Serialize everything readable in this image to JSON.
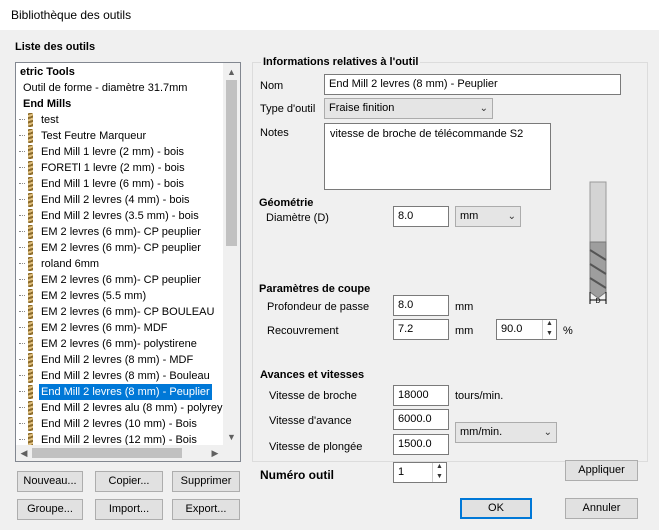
{
  "window": {
    "title": "Bibliothèque des outils"
  },
  "tools_list": {
    "heading": "Liste des outils",
    "rows": [
      {
        "label": "etric Tools",
        "kind": "root"
      },
      {
        "label": "Outil de forme - diamètre 31.7mm",
        "kind": "plain"
      },
      {
        "label": "End Mills",
        "kind": "group"
      },
      {
        "label": "test",
        "kind": "item"
      },
      {
        "label": "Test Feutre Marqueur",
        "kind": "item"
      },
      {
        "label": "End Mill 1 levre (2 mm) - bois",
        "kind": "item"
      },
      {
        "label": "FORETl 1 levre (2 mm) - bois",
        "kind": "item"
      },
      {
        "label": "End Mill 1 levre (6 mm) - bois",
        "kind": "item"
      },
      {
        "label": "End Mill 2 levres (4 mm) - bois",
        "kind": "item"
      },
      {
        "label": "End Mill 2 levres (3.5 mm) - bois",
        "kind": "item"
      },
      {
        "label": "EM 2 levres (6 mm)- CP peuplier",
        "kind": "item"
      },
      {
        "label": "EM 2 levres (6 mm)- CP peuplier",
        "kind": "item"
      },
      {
        "label": "roland 6mm",
        "kind": "item"
      },
      {
        "label": "EM 2 levres (6 mm)- CP peuplier",
        "kind": "item"
      },
      {
        "label": "EM 2 levres (5.5 mm)",
        "kind": "item"
      },
      {
        "label": "EM 2 levres (6 mm)- CP BOULEAU",
        "kind": "item"
      },
      {
        "label": "EM 2 levres (6 mm)- MDF",
        "kind": "item"
      },
      {
        "label": "EM 2 levres (6 mm)- polystirene",
        "kind": "item"
      },
      {
        "label": "End Mill 2 levres (8 mm) - MDF",
        "kind": "item"
      },
      {
        "label": "End Mill 2 levres (8 mm) - Bouleau",
        "kind": "item"
      },
      {
        "label": "End Mill 2 levres (8 mm) - Peuplier",
        "kind": "item",
        "selected": true
      },
      {
        "label": "End Mill 2 levres alu (8 mm) - polyrey",
        "kind": "item"
      },
      {
        "label": "End Mill 2 levres (10 mm) - Bois",
        "kind": "item"
      },
      {
        "label": "End Mill 2 levres (12 mm) - Bois",
        "kind": "item"
      }
    ]
  },
  "buttons": {
    "new": "Nouveau...",
    "copy": "Copier...",
    "delete": "Supprimer",
    "group": "Groupe...",
    "import": "Import...",
    "export": "Export...",
    "apply": "Appliquer",
    "ok": "OK",
    "cancel": "Annuler"
  },
  "info": {
    "heading": "Informations relatives à l'outil",
    "name_label": "Nom",
    "name_value": "End Mill 2 levres (8 mm) - Peuplier",
    "type_label": "Type d'outil",
    "type_value": "Fraise finition",
    "notes_label": "Notes",
    "notes_value": "vitesse de broche de télécommande S2"
  },
  "geometry": {
    "heading": "Géométrie",
    "diameter_label": "Diamètre (D)",
    "diameter_value": "8.0",
    "unit": "mm",
    "diagram_label": "D"
  },
  "cutting": {
    "heading": "Paramètres de coupe",
    "depth_label": "Profondeur de passe",
    "depth_value": "8.0",
    "depth_unit": "mm",
    "stepover_label": "Recouvrement",
    "stepover_value": "7.2",
    "stepover_unit": "mm",
    "stepover_percent": "90.0",
    "percent_sign": "%"
  },
  "feeds": {
    "heading": "Avances et vitesses",
    "spindle_label": "Vitesse de broche",
    "spindle_value": "18000",
    "spindle_unit": "tours/min.",
    "feed_label": "Vitesse d'avance",
    "feed_value": "6000.0",
    "plunge_label": "Vitesse de plongée",
    "plunge_value": "1500.0",
    "rate_unit": "mm/min."
  },
  "tool_number": {
    "label": "Numéro outil",
    "value": "1"
  },
  "colors": {
    "accent": "#0078d7",
    "background": "#f0f0f0"
  }
}
